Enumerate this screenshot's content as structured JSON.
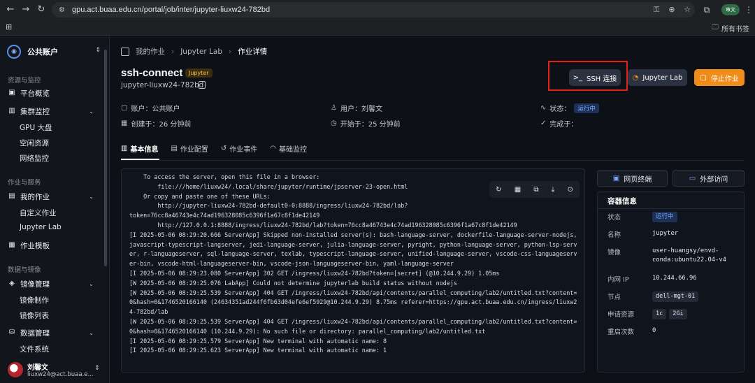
{
  "browser": {
    "url": "gpu.act.buaa.edu.cn/portal/job/inter/jupyter-liuxw24-782bd",
    "bookmarks_all": "所有书签",
    "profile_badge": "审文"
  },
  "sidebar": {
    "account_name": "公共账户",
    "sections": {
      "resources": "资源与监控",
      "jobs": "作业与服务",
      "data": "数据与镜像"
    },
    "items": {
      "overview": "平台概览",
      "cluster": "集群监控",
      "gpu": "GPU 大盘",
      "idle": "空闲资源",
      "network": "网络监控",
      "myjobs": "我的作业",
      "custom": "自定义作业",
      "jupyter": "Jupyter Lab",
      "template": "作业模板",
      "image_mgmt": "镜像管理",
      "image_make": "镜像制作",
      "image_list": "镜像列表",
      "data_mgmt": "数据管理",
      "filesystem": "文件系统"
    },
    "user": {
      "name": "刘馨文",
      "email": "liuxw24@act.buaa.e..."
    }
  },
  "breadcrumb": {
    "items": [
      "我的作业",
      "Jupyter Lab",
      "作业详情"
    ]
  },
  "job": {
    "title": "ssh-connect",
    "tag": "Jupyter",
    "id": "jupyter-liuxw24-782bd",
    "buttons": {
      "ssh": "SSH 连接",
      "jupyter": "Jupyter Lab",
      "stop": "停止作业"
    },
    "meta": {
      "account": "账户：公共账户",
      "user": "用户：刘馨文",
      "status_label": "状态：",
      "status_value": "运行中",
      "created": "创建于：26 分钟前",
      "started": "开始于：25 分钟前",
      "finished": "完成于："
    }
  },
  "tabs": [
    "基本信息",
    "作业配置",
    "作业事件",
    "基础监控"
  ],
  "log": {
    "text": "    To access the server, open this file in a browser:\n        file:///home/liuxw24/.local/share/jupyter/runtime/jpserver-23-open.html\n    Or copy and paste one of these URLs:\n        http://jupyter-liuxw24-782bd-default0-0:8888/ingress/liuxw24-782bd/lab?\ntoken=76cc8a46743e4c74ad196328085c6396f1a67c8f1de42149\n        http://127.0.0.1:8888/ingress/liuxw24-782bd/lab?token=76cc8a46743e4c74ad196328085c6396f1a67c8f1de42149\n[I 2025-05-06 08:29:20.666 ServerApp] Skipped non-installed server(s): bash-language-server, dockerfile-language-server-nodejs, javascript-typescript-langserver, jedi-language-server, julia-language-server, pyright, python-language-server, python-lsp-server, r-languageserver, sql-language-server, texlab, typescript-language-server, unified-language-server, vscode-css-languageserver-bin, vscode-html-languageserver-bin, vscode-json-languageserver-bin, yaml-language-server\n[I 2025-05-06 08:29:23.080 ServerApp] 302 GET /ingress/liuxw24-782bd?token=[secret] (@10.244.9.29) 1.05ms\n[W 2025-05-06 08:29:25.076 LabApp] Could not determine jupyterlab build status without nodejs\n[W 2025-05-06 08:29:25.539 ServerApp] 404 GET /ingress/liuxw24-782bd/api/contents/parallel_computing/lab2/untitled.txt?content=0&hash=0&1746520166140 (24634351ad244f6fb63d04efe6ef5929@10.244.9.29) 8.75ms referer=https://gpu.act.buaa.edu.cn/ingress/liuxw24-782bd/lab\n[W 2025-05-06 08:29:25.539 ServerApp] 404 GET /ingress/liuxw24-782bd/api/contents/parallel_computing/lab2/untitled.txt?content=0&hash=0&1746520166140 (10.244.9.29): No such file or directory: parallel_computing/lab2/untitled.txt\n[I 2025-05-06 08:29:25.579 ServerApp] New terminal with automatic name: 8\n[I 2025-05-06 08:29:25.623 ServerApp] New terminal with automatic name: 1"
  },
  "right": {
    "web_terminal": "网页终端",
    "external_access": "外部访问",
    "container_title": "容器信息",
    "rows": {
      "status_k": "状态",
      "status_v": "运行中",
      "name_k": "名称",
      "name_v": "jupyter",
      "image_k": "镜像",
      "image_v": "user-huangsy/envd-conda:ubuntu22.04-v4",
      "ip_k": "内网 IP",
      "ip_v": "10.244.66.96",
      "node_k": "节点",
      "node_v": "dell-mgt-01",
      "req_k": "申请资源",
      "req_cpu": "1c",
      "req_mem": "2Gi",
      "restart_k": "重启次数",
      "restart_v": "0"
    }
  }
}
